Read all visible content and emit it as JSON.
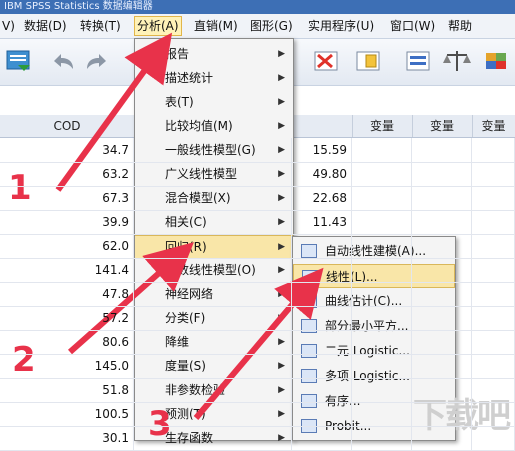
{
  "window": {
    "title": "IBM SPSS Statistics 数据编辑器"
  },
  "menubar": [
    {
      "id": "edit",
      "label": "V)"
    },
    {
      "id": "data",
      "label": "数据(D)"
    },
    {
      "id": "transform",
      "label": "转换(T)"
    },
    {
      "id": "analyze",
      "label": "分析(A)"
    },
    {
      "id": "marketing",
      "label": "直销(M)"
    },
    {
      "id": "graphs",
      "label": "图形(G)"
    },
    {
      "id": "utilities",
      "label": "实用程序(U)"
    },
    {
      "id": "window",
      "label": "窗口(W)"
    },
    {
      "id": "help",
      "label": "帮助"
    }
  ],
  "grid": {
    "columns": [
      "COD",
      "",
      "",
      "变量",
      "变量",
      "变量"
    ],
    "rows": [
      {
        "cod": "34.7",
        "v2": "15.59"
      },
      {
        "cod": "63.2",
        "v2": "49.80"
      },
      {
        "cod": "67.3",
        "v2": "22.68"
      },
      {
        "cod": "39.9",
        "v2": "11.43"
      },
      {
        "cod": "62.0",
        "v2": ""
      },
      {
        "cod": "141.4",
        "v2": ""
      },
      {
        "cod": "47.8",
        "v2": ""
      },
      {
        "cod": "57.2",
        "v2": ""
      },
      {
        "cod": "80.6",
        "v2": ""
      },
      {
        "cod": "145.0",
        "v2": ""
      },
      {
        "cod": "51.8",
        "v2": ""
      },
      {
        "cod": "100.5",
        "v2": ""
      },
      {
        "cod": "30.1",
        "v2": ""
      }
    ]
  },
  "analyze_menu": [
    {
      "label": "报告",
      "submenu": true
    },
    {
      "label": "描述统计",
      "submenu": true
    },
    {
      "label": "表(T)",
      "submenu": true
    },
    {
      "label": "比较均值(M)",
      "submenu": true
    },
    {
      "label": "一般线性模型(G)",
      "submenu": true
    },
    {
      "label": "广义线性模型",
      "submenu": true
    },
    {
      "label": "混合模型(X)",
      "submenu": true
    },
    {
      "label": "相关(C)",
      "submenu": true
    },
    {
      "label": "回归(R)",
      "submenu": true,
      "highlighted": true
    },
    {
      "label": "对数线性模型(O)",
      "submenu": true
    },
    {
      "label": "神经网络",
      "submenu": true
    },
    {
      "label": "分类(F)",
      "submenu": true
    },
    {
      "label": "降维",
      "submenu": true
    },
    {
      "label": "度量(S)",
      "submenu": true
    },
    {
      "label": "非参数检验",
      "submenu": true
    },
    {
      "label": "预测(T)",
      "submenu": true
    },
    {
      "label": "生存函数",
      "submenu": true
    }
  ],
  "regression_menu": [
    {
      "label": "自动线性建模(A)..."
    },
    {
      "label": "线性(L)...",
      "highlighted": true
    },
    {
      "label": "曲线估计(C)..."
    },
    {
      "label": "部分最小平方..."
    },
    {
      "label": "二元 Logistic..."
    },
    {
      "label": "多项 Logistic..."
    },
    {
      "label": "有序..."
    },
    {
      "label": "Probit..."
    }
  ],
  "annotations": {
    "step1": "1",
    "step2": "2",
    "step3": "3"
  },
  "colors": {
    "arrow": "#e8324a",
    "highlight": "#f9e6a8",
    "accent": "#3d6fb5"
  },
  "watermark": "下载吧"
}
